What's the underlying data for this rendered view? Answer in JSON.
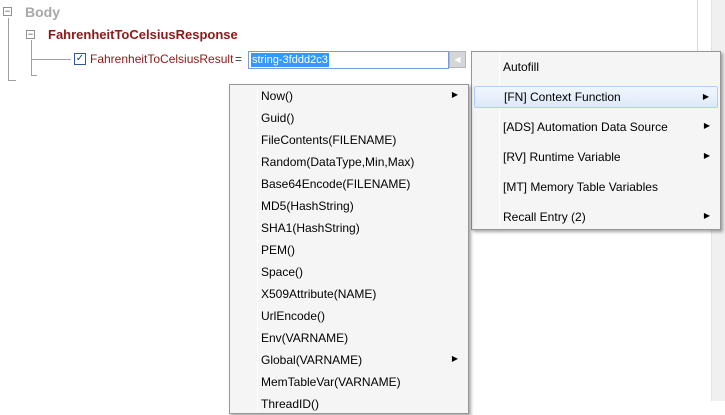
{
  "tree": {
    "body_label": "Body",
    "response_label": "FahrenheitToCelsiusResponse",
    "result": {
      "checked": true,
      "label": "FahrenheitToCelsiusResult",
      "equals": "=",
      "value": "string-3fddd2c3"
    },
    "toggle_symbol": "−",
    "checkbox_symbol": "✓"
  },
  "context_menu": {
    "items": [
      {
        "label": "Autofill",
        "has_submenu": false
      },
      {
        "label": "[FN] Context Function",
        "has_submenu": true,
        "highlighted": true
      },
      {
        "label": "[ADS] Automation Data Source",
        "has_submenu": true
      },
      {
        "label": "[RV] Runtime Variable",
        "has_submenu": true
      },
      {
        "label": "[MT] Memory Table Variables",
        "has_submenu": false
      },
      {
        "label": "Recall Entry (2)",
        "has_submenu": true
      }
    ]
  },
  "function_submenu": {
    "items": [
      {
        "label": "Now()",
        "has_submenu": true
      },
      {
        "label": "Guid()",
        "has_submenu": false
      },
      {
        "label": "FileContents(FILENAME)",
        "has_submenu": false
      },
      {
        "label": "Random(DataType,Min,Max)",
        "has_submenu": false
      },
      {
        "label": "Base64Encode(FILENAME)",
        "has_submenu": false
      },
      {
        "label": "MD5(HashString)",
        "has_submenu": false
      },
      {
        "label": "SHA1(HashString)",
        "has_submenu": false
      },
      {
        "label": "PEM()",
        "has_submenu": false
      },
      {
        "label": "Space()",
        "has_submenu": false
      },
      {
        "label": "X509Attribute(NAME)",
        "has_submenu": false
      },
      {
        "label": "UrlEncode()",
        "has_submenu": false
      },
      {
        "label": "Env(VARNAME)",
        "has_submenu": false
      },
      {
        "label": "Global(VARNAME)",
        "has_submenu": true
      },
      {
        "label": "MemTableVar(VARNAME)",
        "has_submenu": false
      },
      {
        "label": "ThreadID()",
        "has_submenu": false
      }
    ]
  },
  "icons": {
    "submenu_arrow": "▶",
    "dropdown_arrow": "◀"
  },
  "colors": {
    "response_label": "#8b1a1a",
    "body_label": "#a8a8a8",
    "selection": "#3399ff",
    "menu_background": "#f5f5f5"
  }
}
